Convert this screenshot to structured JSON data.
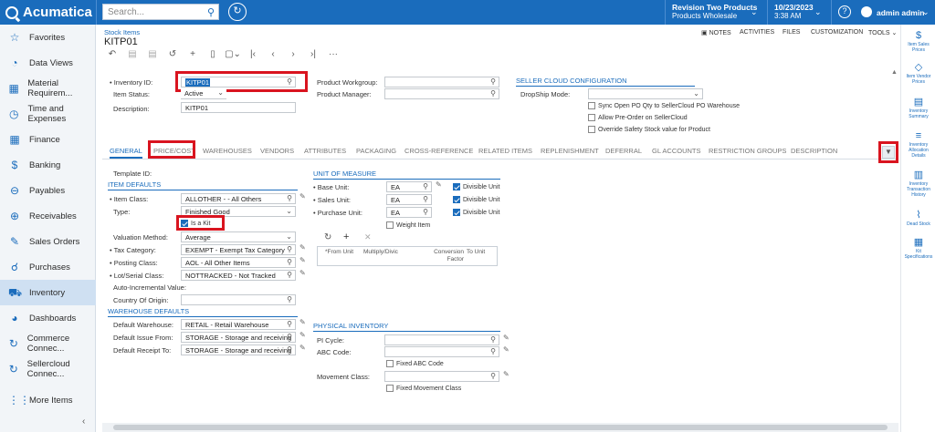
{
  "topbar": {
    "brand": "Acumatica",
    "search_placeholder": "Search...",
    "company": "Revision Two Products",
    "company_sub": "Products Wholesale",
    "date": "10/23/2023",
    "time": "3:38 AM",
    "user": "admin admin"
  },
  "sidebar": {
    "items": [
      {
        "label": "Favorites",
        "icon": "star-icon"
      },
      {
        "label": "Data Views",
        "icon": "pie-chart-icon"
      },
      {
        "label": "Material Requirem...",
        "icon": "factory-icon"
      },
      {
        "label": "Time and Expenses",
        "icon": "clock-icon"
      },
      {
        "label": "Finance",
        "icon": "calculator-icon"
      },
      {
        "label": "Banking",
        "icon": "dollar-icon"
      },
      {
        "label": "Payables",
        "icon": "minus-circle-icon"
      },
      {
        "label": "Receivables",
        "icon": "plus-circle-icon"
      },
      {
        "label": "Sales Orders",
        "icon": "edit-icon"
      },
      {
        "label": "Purchases",
        "icon": "cart-icon"
      },
      {
        "label": "Inventory",
        "icon": "truck-icon"
      },
      {
        "label": "Dashboards",
        "icon": "gauge-icon"
      },
      {
        "label": "Commerce Connec...",
        "icon": "sync-icon"
      },
      {
        "label": "Sellercloud Connec...",
        "icon": "sync-icon"
      },
      {
        "label": "More Items",
        "icon": "grid-icon"
      }
    ]
  },
  "rail": {
    "items": [
      {
        "label": "Item Sales Prices",
        "icon": "$"
      },
      {
        "label": "Item Vendor Prices",
        "icon": "◇"
      },
      {
        "label": "Inventory Summary",
        "icon": "▤"
      },
      {
        "label": "Inventory Allocation Details",
        "icon": "≡"
      },
      {
        "label": "Inventory Transaction History",
        "icon": "▥"
      },
      {
        "label": "Dead Stock",
        "icon": "⌇"
      },
      {
        "label": "Kit Specifications",
        "icon": "▦"
      }
    ]
  },
  "page": {
    "breadcrumb": "Stock Items",
    "title": "KITP01",
    "tools": [
      "NOTES",
      "ACTIVITIES",
      "FILES",
      "CUSTOMIZATION",
      "TOOLS"
    ]
  },
  "header_form": {
    "inventory_id_label": "Inventory ID:",
    "inventory_id": "KITP01",
    "item_status_label": "Item Status:",
    "item_status": "Active",
    "description_label": "Description:",
    "description": "KITP01",
    "product_workgroup_label": "Product Workgroup:",
    "product_manager_label": "Product Manager:",
    "sellercloud_title": "SELLER CLOUD CONFIGURATION",
    "dropship_label": "DropShip Mode:",
    "sync_label": "Sync Open PO Qty to SellerCloud PO Warehouse",
    "preorder_label": "Allow Pre-Order on SellerCloud",
    "override_label": "Override Safety Stock value for Product"
  },
  "tabs": [
    "GENERAL",
    "PRICE/COST",
    "WAREHOUSES",
    "VENDORS",
    "ATTRIBUTES",
    "PACKAGING",
    "CROSS-REFERENCE",
    "RELATED ITEMS",
    "REPLENISHMENT",
    "DEFERRAL",
    "GL ACCOUNTS",
    "RESTRICTION GROUPS",
    "DESCRIPTION"
  ],
  "general": {
    "template_id_label": "Template ID:",
    "item_defaults_title": "ITEM DEFAULTS",
    "item_class_label": "Item Class:",
    "item_class": "ALLOTHER  -  - All Others",
    "type_label": "Type:",
    "type": "Finished Good",
    "is_kit_label": "Is a Kit",
    "valuation_label": "Valuation Method:",
    "valuation": "Average",
    "tax_category_label": "Tax Category:",
    "tax_category": "EXEMPT - Exempt Tax Category",
    "posting_class_label": "Posting Class:",
    "posting_class": "AOL - All Other Items",
    "lot_serial_label": "Lot/Serial Class:",
    "lot_serial": "NOTTRACKED - Not Tracked",
    "auto_incr_label": "Auto-Incremental Value:",
    "country_label": "Country Of Origin:",
    "warehouse_defaults_title": "WAREHOUSE DEFAULTS",
    "default_wh_label": "Default Warehouse:",
    "default_wh": "RETAIL - Retail Warehouse",
    "default_issue_label": "Default Issue From:",
    "default_issue": "STORAGE - Storage and receiving",
    "default_receipt_label": "Default Receipt To:",
    "default_receipt": "STORAGE - Storage and receiving",
    "uom_title": "UNIT OF MEASURE",
    "base_unit_label": "Base Unit:",
    "base_unit": "EA",
    "sales_unit_label": "Sales Unit:",
    "sales_unit": "EA",
    "purchase_unit_label": "Purchase Unit:",
    "purchase_unit": "EA",
    "divisible_label": "Divisible Unit",
    "weight_item_label": "Weight Item",
    "grid_headers": [
      "*From Unit",
      "Multiply/Divic",
      "Conversion Factor",
      "To Unit"
    ],
    "physical_inventory_title": "PHYSICAL INVENTORY",
    "pi_cycle_label": "PI Cycle:",
    "abc_code_label": "ABC Code:",
    "fixed_abc_label": "Fixed ABC Code",
    "movement_class_label": "Movement Class:",
    "fixed_movement_label": "Fixed Movement Class"
  }
}
